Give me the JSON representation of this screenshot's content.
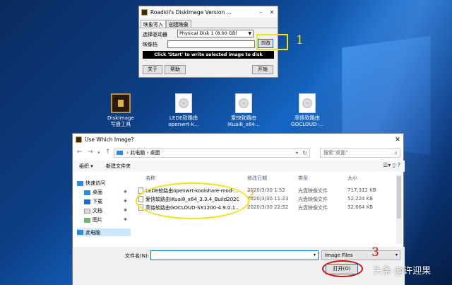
{
  "diskimage_window": {
    "title": "Roadkil's DiskImage Version ...",
    "tabs": [
      "映象写入",
      "创建映象"
    ],
    "drive_label": "选择驱动器",
    "drive_value": "Physical Disk 1 (8.00 GB)",
    "file_label": "映像档",
    "browse_label": "浏览",
    "status_text": "Click 'Start' to write selected image to disk",
    "about_label": "关于",
    "help_label": "帮助",
    "start_label": "开始"
  },
  "annotations": {
    "one": "1",
    "two": "2",
    "three": "3"
  },
  "desktop_icons": [
    {
      "label": "DiskImage\n写盘工具",
      "icon": "app-icon"
    },
    {
      "label": "LEDE软路由\nopenwrt-k...",
      "icon": "disc-image-icon"
    },
    {
      "label": "爱快软路由\niKuai8_x64...",
      "icon": "disc-image-icon"
    },
    {
      "label": "高恪软路由\nGOCLOUD-...",
      "icon": "disc-image-icon"
    }
  ],
  "open_dialog": {
    "title": "Use Which Image?",
    "path": [
      "此电脑",
      "桌面"
    ],
    "search_placeholder": "搜索\"桌面\"",
    "organize_label": "组织 ▾",
    "new_folder_label": "新建文件夹",
    "nav_items": [
      "快速访问",
      "桌面",
      "下载",
      "文档",
      "图片",
      "此电脑"
    ],
    "columns": [
      "名称",
      "修改日期",
      "类型",
      "大小"
    ],
    "files": [
      {
        "name": "LEDE软路由openwrt-koolshare-mod-...",
        "date": "2020/3/30 1:52",
        "type": "光盘映像文件",
        "size": "717,312 KB"
      },
      {
        "name": "爱快软路由iKuai8_x64_3.3.4_Build2020...",
        "date": "2020/3/30 11:23",
        "type": "光盘映像文件",
        "size": "52,224 KB"
      },
      {
        "name": "高恪软路由GOCLOUD-SX1200-4.9.0.1...",
        "date": "2020/3/30 22:52",
        "type": "光盘映像文件",
        "size": "32,664 KB"
      }
    ],
    "filename_label": "文件名(N):",
    "filename_value": "",
    "filetype_value": "Image Files",
    "open_label": "打开(O)"
  },
  "watermark": "头条 @许迎果"
}
